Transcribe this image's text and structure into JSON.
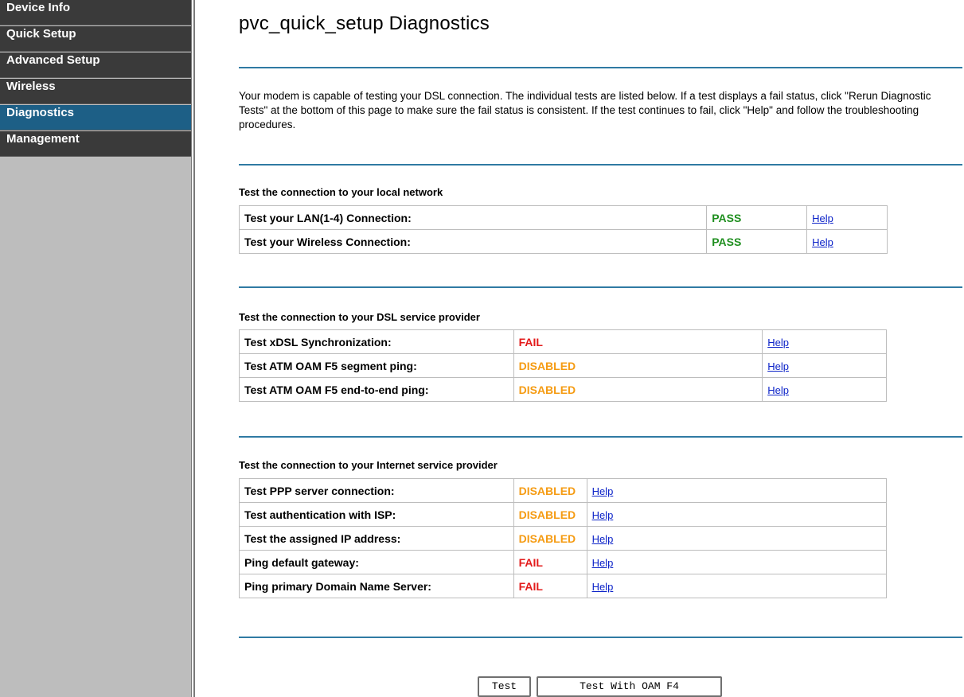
{
  "sidebar": {
    "items": [
      {
        "label": "Device Info",
        "active": false
      },
      {
        "label": "Quick Setup",
        "active": false
      },
      {
        "label": "Advanced Setup",
        "active": false
      },
      {
        "label": "Wireless",
        "active": false
      },
      {
        "label": "Diagnostics",
        "active": true
      },
      {
        "label": "Management",
        "active": false
      }
    ]
  },
  "page": {
    "title": "pvc_quick_setup Diagnostics",
    "intro": "Your modem is capable of testing your DSL connection. The individual tests are listed below. If a test displays a fail status, click \"Rerun Diagnostic Tests\" at the bottom of this page to make sure the fail status is consistent. If the test continues to fail, click \"Help\" and follow the troubleshooting procedures."
  },
  "sections": {
    "local": {
      "title": "Test the connection to your local network",
      "rows": [
        {
          "label": "Test your LAN(1-4) Connection:",
          "status": "PASS",
          "status_type": "pass",
          "help": "Help"
        },
        {
          "label": "Test your Wireless Connection:",
          "status": "PASS",
          "status_type": "pass",
          "help": "Help"
        }
      ]
    },
    "dsl": {
      "title": "Test the connection to your DSL service provider",
      "rows": [
        {
          "label": "Test xDSL Synchronization:",
          "status": "FAIL",
          "status_type": "fail",
          "help": "Help"
        },
        {
          "label": "Test ATM OAM F5 segment ping:",
          "status": "DISABLED",
          "status_type": "disabled",
          "help": "Help"
        },
        {
          "label": "Test ATM OAM F5 end-to-end ping:",
          "status": "DISABLED",
          "status_type": "disabled",
          "help": "Help"
        }
      ]
    },
    "isp": {
      "title": "Test the connection to your Internet service provider",
      "rows": [
        {
          "label": "Test PPP server connection:",
          "status": "DISABLED",
          "status_type": "disabled",
          "help": "Help"
        },
        {
          "label": "Test authentication with ISP:",
          "status": "DISABLED",
          "status_type": "disabled",
          "help": "Help"
        },
        {
          "label": "Test the assigned IP address:",
          "status": "DISABLED",
          "status_type": "disabled",
          "help": "Help"
        },
        {
          "label": "Ping default gateway:",
          "status": "FAIL",
          "status_type": "fail",
          "help": "Help"
        },
        {
          "label": "Ping primary Domain Name Server:",
          "status": "FAIL",
          "status_type": "fail",
          "help": "Help"
        }
      ]
    }
  },
  "buttons": {
    "test": "Test",
    "test_oam_f4": "Test With OAM F4"
  },
  "colors": {
    "sidebar_bg": "#bdbdbd",
    "nav_item_bg": "#3a3a3a",
    "nav_active_bg": "#1d5f86",
    "rule": "#2f7aa3",
    "pass": "#1f8f1f",
    "fail": "#e31b1b",
    "disabled": "#f59b12",
    "link": "#0b22c8"
  }
}
